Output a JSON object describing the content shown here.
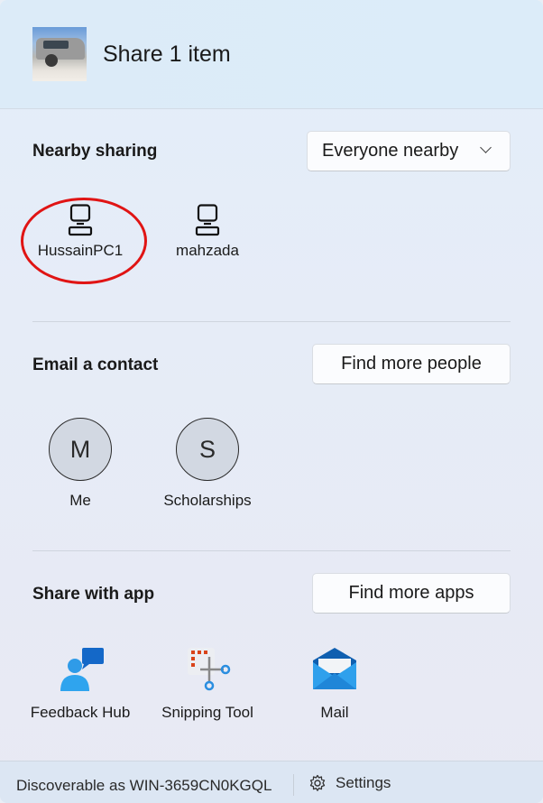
{
  "header": {
    "title": "Share 1 item",
    "thumbnail": "vehicle-photo"
  },
  "nearby": {
    "title": "Nearby sharing",
    "dropdown_value": "Everyone nearby",
    "devices": [
      {
        "name": "HussainPC1",
        "icon": "computer-icon",
        "highlighted": true
      },
      {
        "name": "mahzada",
        "icon": "computer-icon",
        "highlighted": false
      }
    ],
    "highlight_color": "#e01414"
  },
  "email": {
    "title": "Email a contact",
    "button": "Find more people",
    "contacts": [
      {
        "initial": "M",
        "name": "Me"
      },
      {
        "initial": "S",
        "name": "Scholarships"
      }
    ]
  },
  "apps": {
    "title": "Share with app",
    "button": "Find more apps",
    "items": [
      {
        "name": "Feedback Hub",
        "icon": "feedback-hub-icon"
      },
      {
        "name": "Snipping Tool",
        "icon": "snipping-tool-icon"
      },
      {
        "name": "Mail",
        "icon": "mail-icon"
      }
    ]
  },
  "footer": {
    "discoverable": "Discoverable as WIN-3659CN0KGQL",
    "settings": "Settings"
  }
}
